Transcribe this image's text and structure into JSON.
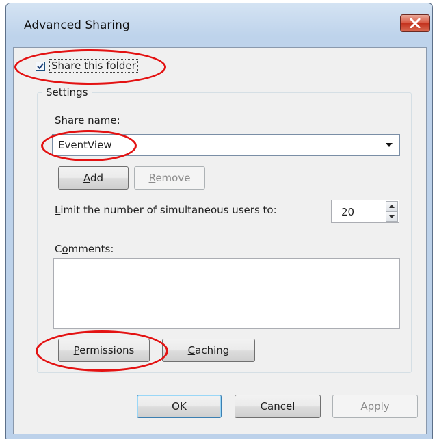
{
  "window": {
    "title": "Advanced Sharing"
  },
  "share_checkbox": {
    "checked": true,
    "label_mnemonic": "S",
    "label_rest": "hare this folder"
  },
  "settings": {
    "group_title": "Settings",
    "share_name_label_pre": "S",
    "share_name_label_mnemonic": "h",
    "share_name_label_rest": "are name:",
    "share_name_value": "EventView",
    "add_button_mnemonic": "A",
    "add_button_rest": "dd",
    "remove_button_mnemonic": "R",
    "remove_button_rest": "emove",
    "limit_label_mnemonic": "L",
    "limit_label_rest": "imit the number of simultaneous users to:",
    "limit_value": "20",
    "comments_label_pre": "C",
    "comments_label_mnemonic": "o",
    "comments_label_rest": "mments:",
    "comments_value": "",
    "permissions_button_mnemonic": "P",
    "permissions_button_rest": "ermissions",
    "caching_button_mnemonic": "C",
    "caching_button_rest": "aching"
  },
  "footer": {
    "ok_label": "OK",
    "cancel_label": "Cancel",
    "apply_label": "Apply"
  },
  "colors": {
    "highlight_ellipse": "#e31212",
    "title_bar": "#bcd1ea",
    "close_button": "#c3321e",
    "dialog_background": "#f0f0f0"
  }
}
